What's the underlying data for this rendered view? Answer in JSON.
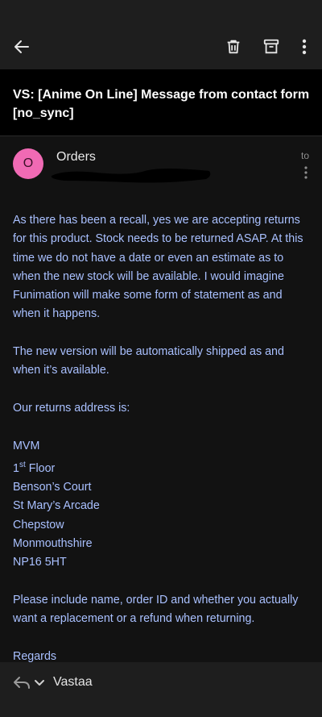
{
  "toolbar": {
    "back_icon": "arrow-left-icon",
    "delete_icon": "trash-icon",
    "archive_icon": "archive-icon",
    "more_icon": "more-vertical-icon"
  },
  "email": {
    "subject": "VS: [Anime On Line] Message from contact form [no_sync]",
    "avatar_letter": "O",
    "avatar_color": "#f06ab4",
    "sender": "Orders",
    "to_label": "to",
    "body": {
      "p1": "As there has been a recall, yes we are accepting returns for this product. Stock needs to be returned ASAP. At this time we do not have a date or even an estimate as to when the new stock will be available. I would imagine Funimation will make some form of statement as and when it happens.",
      "p2": "The new version will be automatically shipped as and when it’s available.",
      "p3": "Our returns address is:",
      "address": {
        "line1": "MVM",
        "line2_num": "1",
        "line2_sup": "st",
        "line2_rest": " Floor",
        "line3": "Benson’s Court",
        "line4": "St Mary’s Arcade",
        "line5": "Chepstow",
        "line6": "Monmouthshire",
        "line7": "NP16 5HT"
      },
      "p4": "Please include name, order ID and whether you actually want a replacement or a refund when returning.",
      "closing": "Regards"
    }
  },
  "footer": {
    "reply_label": "Vastaa",
    "reply_icon": "reply-icon",
    "chevron_icon": "chevron-down-icon"
  },
  "colors": {
    "body_text": "#a9c0ff",
    "background": "#121212",
    "toolbar": "#1e1e1e"
  }
}
